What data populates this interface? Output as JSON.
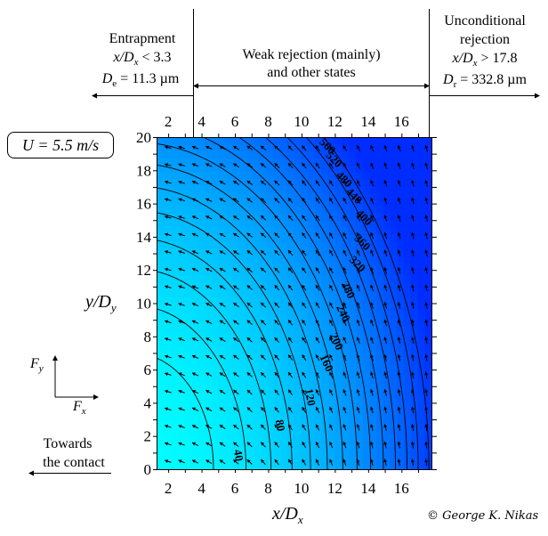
{
  "chart_data": {
    "type": "heatmap",
    "subtype": "contour-with-vector-field",
    "xlabel": "x/D_x",
    "ylabel": "y/D_y",
    "xlim": [
      1.3,
      17.8
    ],
    "ylim": [
      0,
      20
    ],
    "x_ticks": [
      2,
      4,
      6,
      8,
      10,
      12,
      14,
      16
    ],
    "y_ticks": [
      0,
      2,
      4,
      6,
      8,
      10,
      12,
      14,
      16,
      18,
      20
    ],
    "contour_levels": [
      40,
      80,
      120,
      160,
      200,
      240,
      280,
      320,
      360,
      400,
      440,
      480,
      520,
      560
    ],
    "contour_labels": [
      "40",
      "80",
      "120",
      "160",
      "200",
      "240",
      "280",
      "320",
      "360",
      "400",
      "440",
      "480",
      "520",
      "560"
    ],
    "colormap": {
      "low": "#00ffff",
      "high": "#0033ff"
    },
    "vector_field": "force direction arrows (F_x, F_y), pointing left near bottom-left, up-left in mid-region, up near right edge",
    "regions": [
      {
        "name": "Entrapment",
        "condition": "x/D_x < 3.3",
        "size": "D_e = 11.3 µm"
      },
      {
        "name": "Weak rejection (mainly) and other states"
      },
      {
        "name": "Unconditional rejection",
        "condition": "x/D_x > 17.8",
        "size": "D_r = 332.8 µm"
      }
    ],
    "grid": false
  },
  "annotations": {
    "entrapment_title": "Entrapment",
    "entrapment_cond_prefix": "x/D",
    "entrapment_cond_sub": "x",
    "entrapment_cond_suffix": " < 3.3",
    "entrapment_size_prefix": "D",
    "entrapment_size_sub": "e",
    "entrapment_size_suffix": " = 11.3 µm",
    "weak_line1": "Weak rejection (mainly)",
    "weak_line2": "and other states",
    "uncond_line1": "Unconditional",
    "uncond_line2": "rejection",
    "uncond_cond_prefix": "x/D",
    "uncond_cond_sub": "x",
    "uncond_cond_suffix": " > 17.8",
    "uncond_size_prefix": "D",
    "uncond_size_sub": "r",
    "uncond_size_suffix": " = 332.8 µm",
    "velocity_label": "U = 5.5 m/s",
    "fy_label": "F",
    "fy_sub": "y",
    "fx_label": "F",
    "fx_sub": "x",
    "towards_line1": "Towards",
    "towards_line2": "the contact",
    "ylabel_main": "y/D",
    "ylabel_sub": "y",
    "xlabel_main": "x/D",
    "xlabel_sub": "x",
    "copyright": "© George K. Nikas"
  }
}
